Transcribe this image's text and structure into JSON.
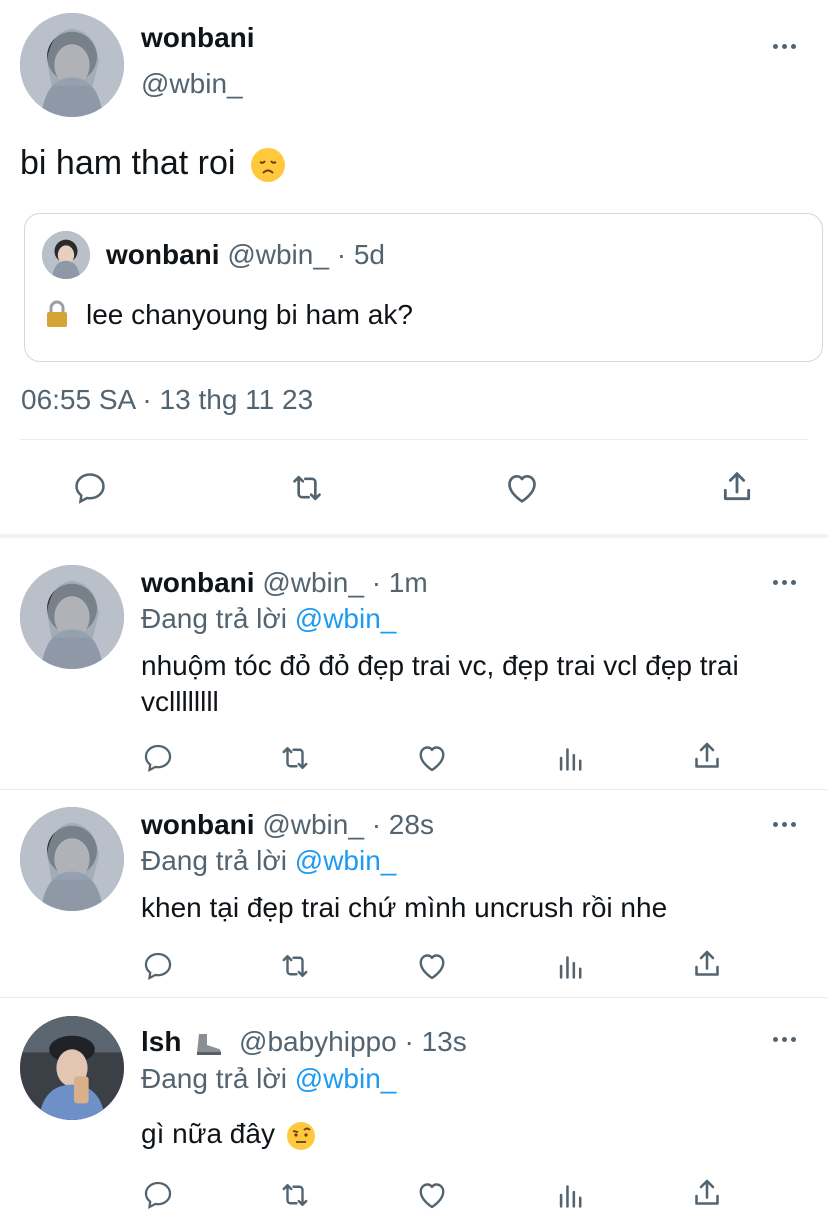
{
  "main_tweet": {
    "display_name": "wonbani",
    "handle": "@wbin_",
    "text": "bi ham that roi",
    "emoji": "disappointed-face",
    "quoted": {
      "display_name": "wonbani",
      "handle": "@wbin_",
      "separator": "·",
      "age": "5d",
      "lock_icon": "lock",
      "text": "lee chanyoung bi ham ak?"
    },
    "timestamp": "06:55 SA · 13 thg 11 23",
    "actions": [
      "reply-icon",
      "retweet-icon",
      "like-icon",
      "share-icon"
    ]
  },
  "replies": [
    {
      "display_name": "wonbani",
      "handle": "@wbin_",
      "age": "· 1m",
      "replying_prefix": "Đang trả lời",
      "replying_to": "@wbin_",
      "text": "nhuộm tóc đỏ đỏ đẹp trai vc, đẹp trai vcl đẹp trai vcllllllll"
    },
    {
      "display_name": "wonbani",
      "handle": "@wbin_",
      "age": "· 28s",
      "replying_prefix": "Đang trả lời",
      "replying_to": "@wbin_",
      "text": "khen tại đẹp trai chứ mình uncrush rồi nhe"
    },
    {
      "display_name": "lsh",
      "name_emoji": "boot",
      "handle": "@babyhippo",
      "age": "· 13s",
      "replying_prefix": "Đang trả lời",
      "replying_to": "@wbin_",
      "text": "gì nữa đây",
      "emoji": "face-with-raised-eyebrow"
    }
  ],
  "reply_actions": [
    "reply-icon",
    "retweet-icon",
    "like-icon",
    "analytics-icon",
    "share-icon"
  ],
  "colors": {
    "link": "#1d9bf0",
    "secondary": "#536471",
    "text": "#0f1419"
  }
}
